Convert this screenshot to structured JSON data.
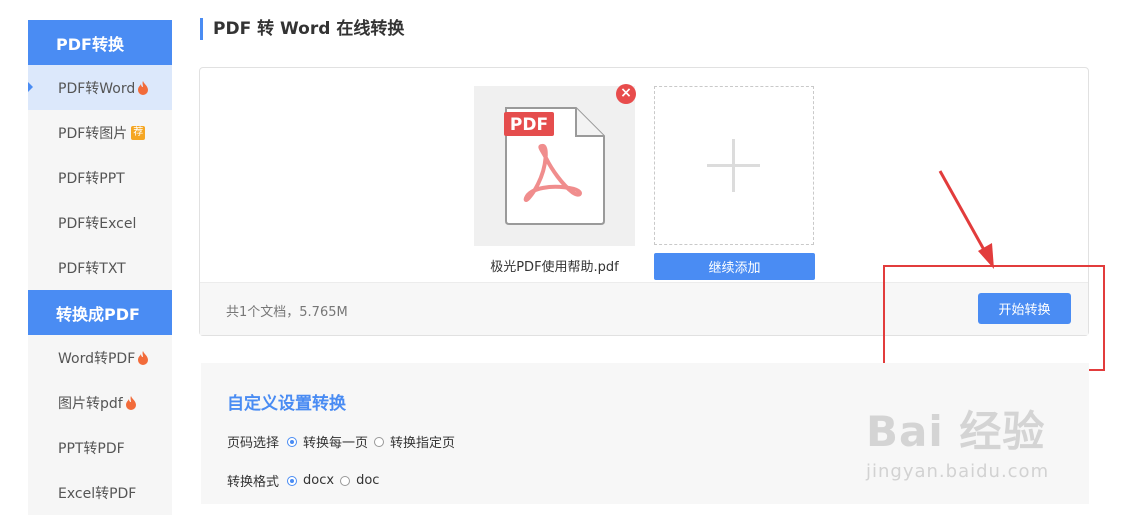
{
  "header": {
    "title": "PDF 转 Word 在线转换"
  },
  "sidebar": {
    "groups": [
      {
        "title": "PDF转换",
        "items": [
          {
            "label": "PDF转Word",
            "badge": "hot"
          },
          {
            "label": "PDF转图片",
            "badge": "荐"
          },
          {
            "label": "PDF转PPT"
          },
          {
            "label": "PDF转Excel"
          },
          {
            "label": "PDF转TXT"
          }
        ]
      },
      {
        "title": "转换成PDF",
        "items": [
          {
            "label": "Word转PDF",
            "badge": "hot"
          },
          {
            "label": "图片转pdf",
            "badge": "hot"
          },
          {
            "label": "PPT转PDF"
          },
          {
            "label": "Excel转PDF"
          }
        ]
      }
    ]
  },
  "upload": {
    "file": {
      "name": "极光PDF使用帮助.pdf",
      "icon": "pdf-file-icon",
      "badge_text": "PDF"
    },
    "add_more_label": "继续添加",
    "summary": "共1个文档，5.765M",
    "start_label": "开始转换"
  },
  "settings": {
    "title": "自定义设置转换",
    "page_select": {
      "label": "页码选择",
      "options": [
        "转换每一页",
        "转换指定页"
      ],
      "selected": "转换每一页"
    },
    "format": {
      "label": "转换格式",
      "options": [
        "docx",
        "doc"
      ],
      "selected": "docx"
    }
  },
  "watermark": {
    "main": "Bai 经验",
    "sub": "jingyan.baidu.com"
  },
  "colors": {
    "accent": "#4a8cf3",
    "annotation": "#e23c3c",
    "remove": "#e84c4c"
  }
}
